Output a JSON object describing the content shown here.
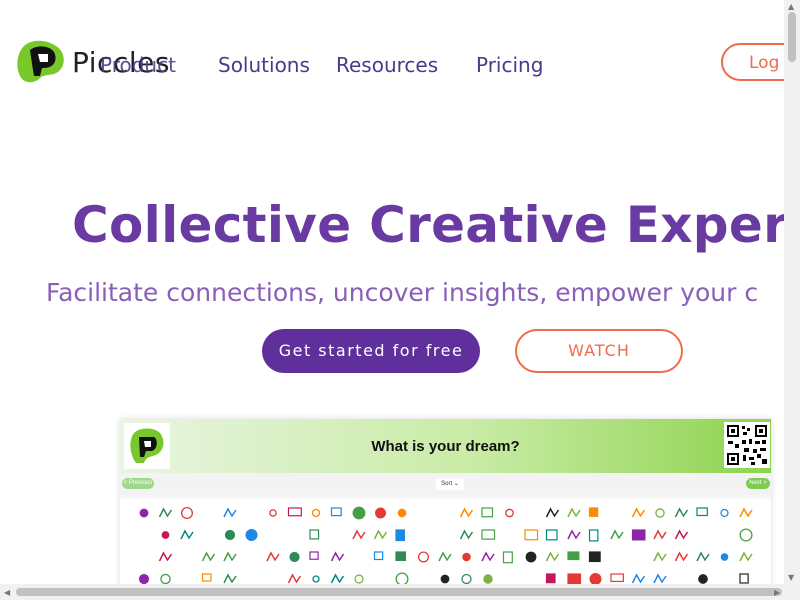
{
  "brand": {
    "name": "Piccles"
  },
  "nav": {
    "items": [
      {
        "label": "Product"
      },
      {
        "label": "Solutions"
      },
      {
        "label": "Resources"
      },
      {
        "label": "Pricing"
      }
    ],
    "login_label": "Log"
  },
  "hero": {
    "title": "Collective Creative Experien",
    "subtitle": "Facilitate connections, uncover insights, empower your c",
    "cta_primary": "Get started for free",
    "cta_secondary": "WATCH"
  },
  "preview": {
    "question": "What is your dream?",
    "prev_label": "< Previous",
    "sort_label": "Sort ⌄",
    "next_label": "Next >"
  },
  "colors": {
    "brand_purple": "#6a3aa3",
    "cta_purple": "#5f2f9b",
    "accent_orange": "#ee6b4d",
    "logo_green": "#7ccc2f"
  }
}
